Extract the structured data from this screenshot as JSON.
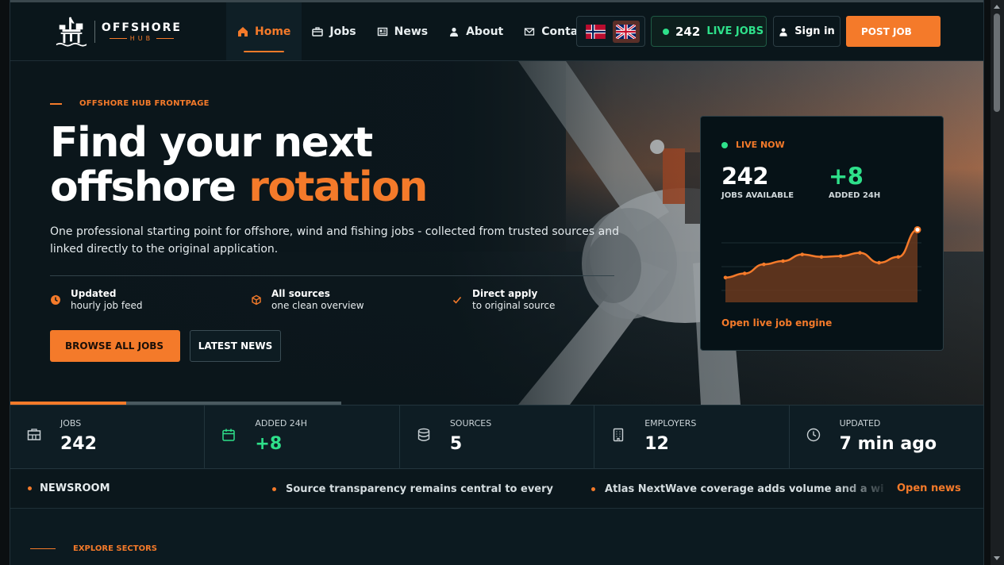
{
  "brand": {
    "name": "OFFSHORE",
    "sub": "HUB"
  },
  "nav": [
    {
      "label": "Home",
      "icon": "home-icon",
      "active": true
    },
    {
      "label": "Jobs",
      "icon": "briefcase-icon"
    },
    {
      "label": "News",
      "icon": "newspaper-icon"
    },
    {
      "label": "About",
      "icon": "user-icon"
    },
    {
      "label": "Contact",
      "icon": "mail-icon"
    }
  ],
  "languages": [
    {
      "code": "no",
      "icon": "norway-flag-icon"
    },
    {
      "code": "en",
      "icon": "uk-flag-icon",
      "selected": true
    }
  ],
  "live_pill": {
    "count": "242",
    "label": "LIVE JOBS"
  },
  "header_actions": {
    "signin": "Sign in",
    "post_job": "POST JOB"
  },
  "hero": {
    "eyebrow": "OFFSHORE HUB FRONTPAGE",
    "title_line1": "Find your next",
    "title_line2_plain": "offshore",
    "title_line2_accent": "rotation",
    "lead": "One professional starting point for offshore, wind and fishing jobs - collected from trusted sources and linked directly to the original application.",
    "features": [
      {
        "icon": "clock-icon",
        "line1": "Updated",
        "line2": "hourly job feed"
      },
      {
        "icon": "cube-icon",
        "line1": "All sources",
        "line2": "one clean overview"
      },
      {
        "icon": "check-icon",
        "line1": "Direct apply",
        "line2": "to original source"
      }
    ],
    "buttons": {
      "browse": "BROWSE ALL JOBS",
      "news": "LATEST NEWS"
    },
    "slider_progress": 0.35
  },
  "live_card": {
    "label": "LIVE NOW",
    "jobs_value": "242",
    "jobs_label": "JOBS AVAILABLE",
    "added_value": "+8",
    "added_label": "ADDED 24H",
    "link": "Open live job engine",
    "chart_data": {
      "type": "area",
      "values": [
        30,
        35,
        46,
        50,
        58,
        55,
        56,
        60,
        48,
        55,
        88
      ]
    }
  },
  "stats": [
    {
      "icon": "grid-box-icon",
      "label": "JOBS",
      "value": "242"
    },
    {
      "icon": "calendar-icon",
      "label": "ADDED 24H",
      "value": "+8",
      "accent": true
    },
    {
      "icon": "database-icon",
      "label": "SOURCES",
      "value": "5"
    },
    {
      "icon": "building-icon",
      "label": "EMPLOYERS",
      "value": "12"
    },
    {
      "icon": "clock-icon",
      "label": "UPDATED",
      "value": "7 min ago"
    }
  ],
  "newsroom": {
    "label": "NEWSROOM",
    "items": [
      "Source transparency remains central to every",
      "Atlas NextWave coverage adds volume and a wider offshore m"
    ],
    "open": "Open news"
  },
  "explore": "EXPLORE SECTORS",
  "colors": {
    "accent": "#f47a2a",
    "live": "#2ee08a",
    "bg": "#0c1a20"
  }
}
